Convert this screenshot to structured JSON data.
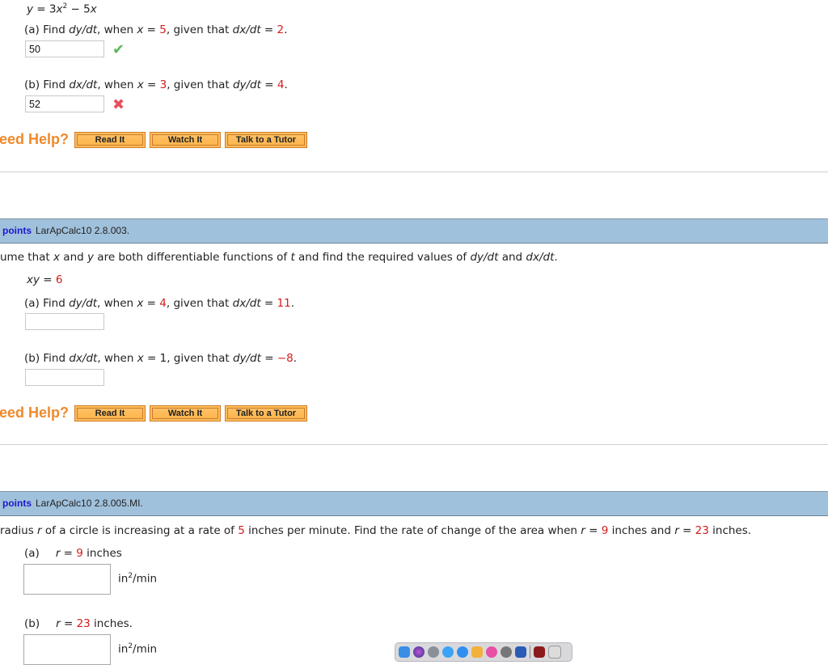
{
  "q1": {
    "equation": {
      "y": "y",
      "eq": " = 3",
      "x": "x",
      "sup": "2",
      "minus": " − 5",
      "x2": "x"
    },
    "part_a": {
      "prefix": "(a) Find ",
      "find": "dy/dt",
      "when": ", when ",
      "var": "x",
      "eq": " = ",
      "x_val": "5",
      "given": ", given that ",
      "given_var": "dx/dt",
      "eq2": " = ",
      "given_val": "2",
      "end": ".",
      "answer": "50",
      "status": "correct",
      "status_icon": "✔",
      "status_color": "#5cb85c"
    },
    "part_b": {
      "prefix": "(b) Find ",
      "find": "dx/dt",
      "when": ", when ",
      "var": "x",
      "eq": " = ",
      "x_val": "3",
      "given": ", given that ",
      "given_var": "dy/dt",
      "eq2": " = ",
      "given_val": "4",
      "end": ".",
      "answer": "52",
      "status": "incorrect",
      "status_icon": "✖",
      "status_color": "#e8505b"
    },
    "help": {
      "label": "eed Help?",
      "buttons": [
        "Read It",
        "Watch It",
        "Talk to a Tutor"
      ]
    }
  },
  "q2": {
    "header": {
      "points": "points",
      "id": "LarApCalc10 2.8.003."
    },
    "instruction": {
      "t1": "ume that ",
      "x": "x",
      "t2": " and ",
      "y": "y",
      "t3": " are both differentiable functions of ",
      "t": "t",
      "t4": " and find the required values of ",
      "dy": "dy/dt",
      "t5": " and ",
      "dx": "dx/dt",
      "t6": "."
    },
    "equation": {
      "xy": "xy",
      "eq": " = ",
      "val": "6"
    },
    "part_a": {
      "prefix": "(a) Find ",
      "find": "dy/dt",
      "when": ", when ",
      "var": "x",
      "eq": " = ",
      "x_val": "4",
      "given": ", given that  ",
      "given_var": "dx/dt",
      "eq2": " = ",
      "given_val": "11",
      "end": ".",
      "answer": ""
    },
    "part_b": {
      "prefix": "(b) Find ",
      "find": "dx/dt",
      "when": ", when ",
      "var": "x",
      "eq": " = ",
      "x_val": "1",
      "given": ", given that  ",
      "given_var": "dy/dt",
      "eq2": " = ",
      "given_val": "−8",
      "end": ".",
      "answer": ""
    },
    "help": {
      "label": "eed Help?",
      "buttons": [
        "Read It",
        "Watch It",
        "Talk to a Tutor"
      ]
    }
  },
  "q3": {
    "header": {
      "points": "points",
      "id": "LarApCalc10 2.8.005.MI."
    },
    "statement": {
      "t1": " radius ",
      "r": "r",
      "t2": " of a circle is increasing at a rate of ",
      "rate": "5",
      "t3": " inches per minute. Find the rate of change of the area when ",
      "r2": "r",
      "t4": " = ",
      "v1": "9",
      "t5": " inches and ",
      "r3": "r",
      "t6": " = ",
      "v2": "23",
      "t7": " inches."
    },
    "part_a": {
      "label": "(a)",
      "r": "r",
      "eq": " = ",
      "val": "9",
      "unit": " inches",
      "answer": "",
      "units": {
        "base": "in",
        "sup": "2",
        "rest": "/min"
      }
    },
    "part_b": {
      "label": "(b)",
      "r": "r",
      "eq": " = ",
      "val": "23",
      "unit": " inches.",
      "answer": "",
      "units": {
        "base": "in",
        "sup": "2",
        "rest": "/min"
      }
    }
  },
  "dock": {
    "apps": [
      "finder",
      "siri",
      "launchpad",
      "messages",
      "safari",
      "preview",
      "itunes",
      "system-preferences",
      "word",
      "acrobat",
      "trash"
    ]
  }
}
